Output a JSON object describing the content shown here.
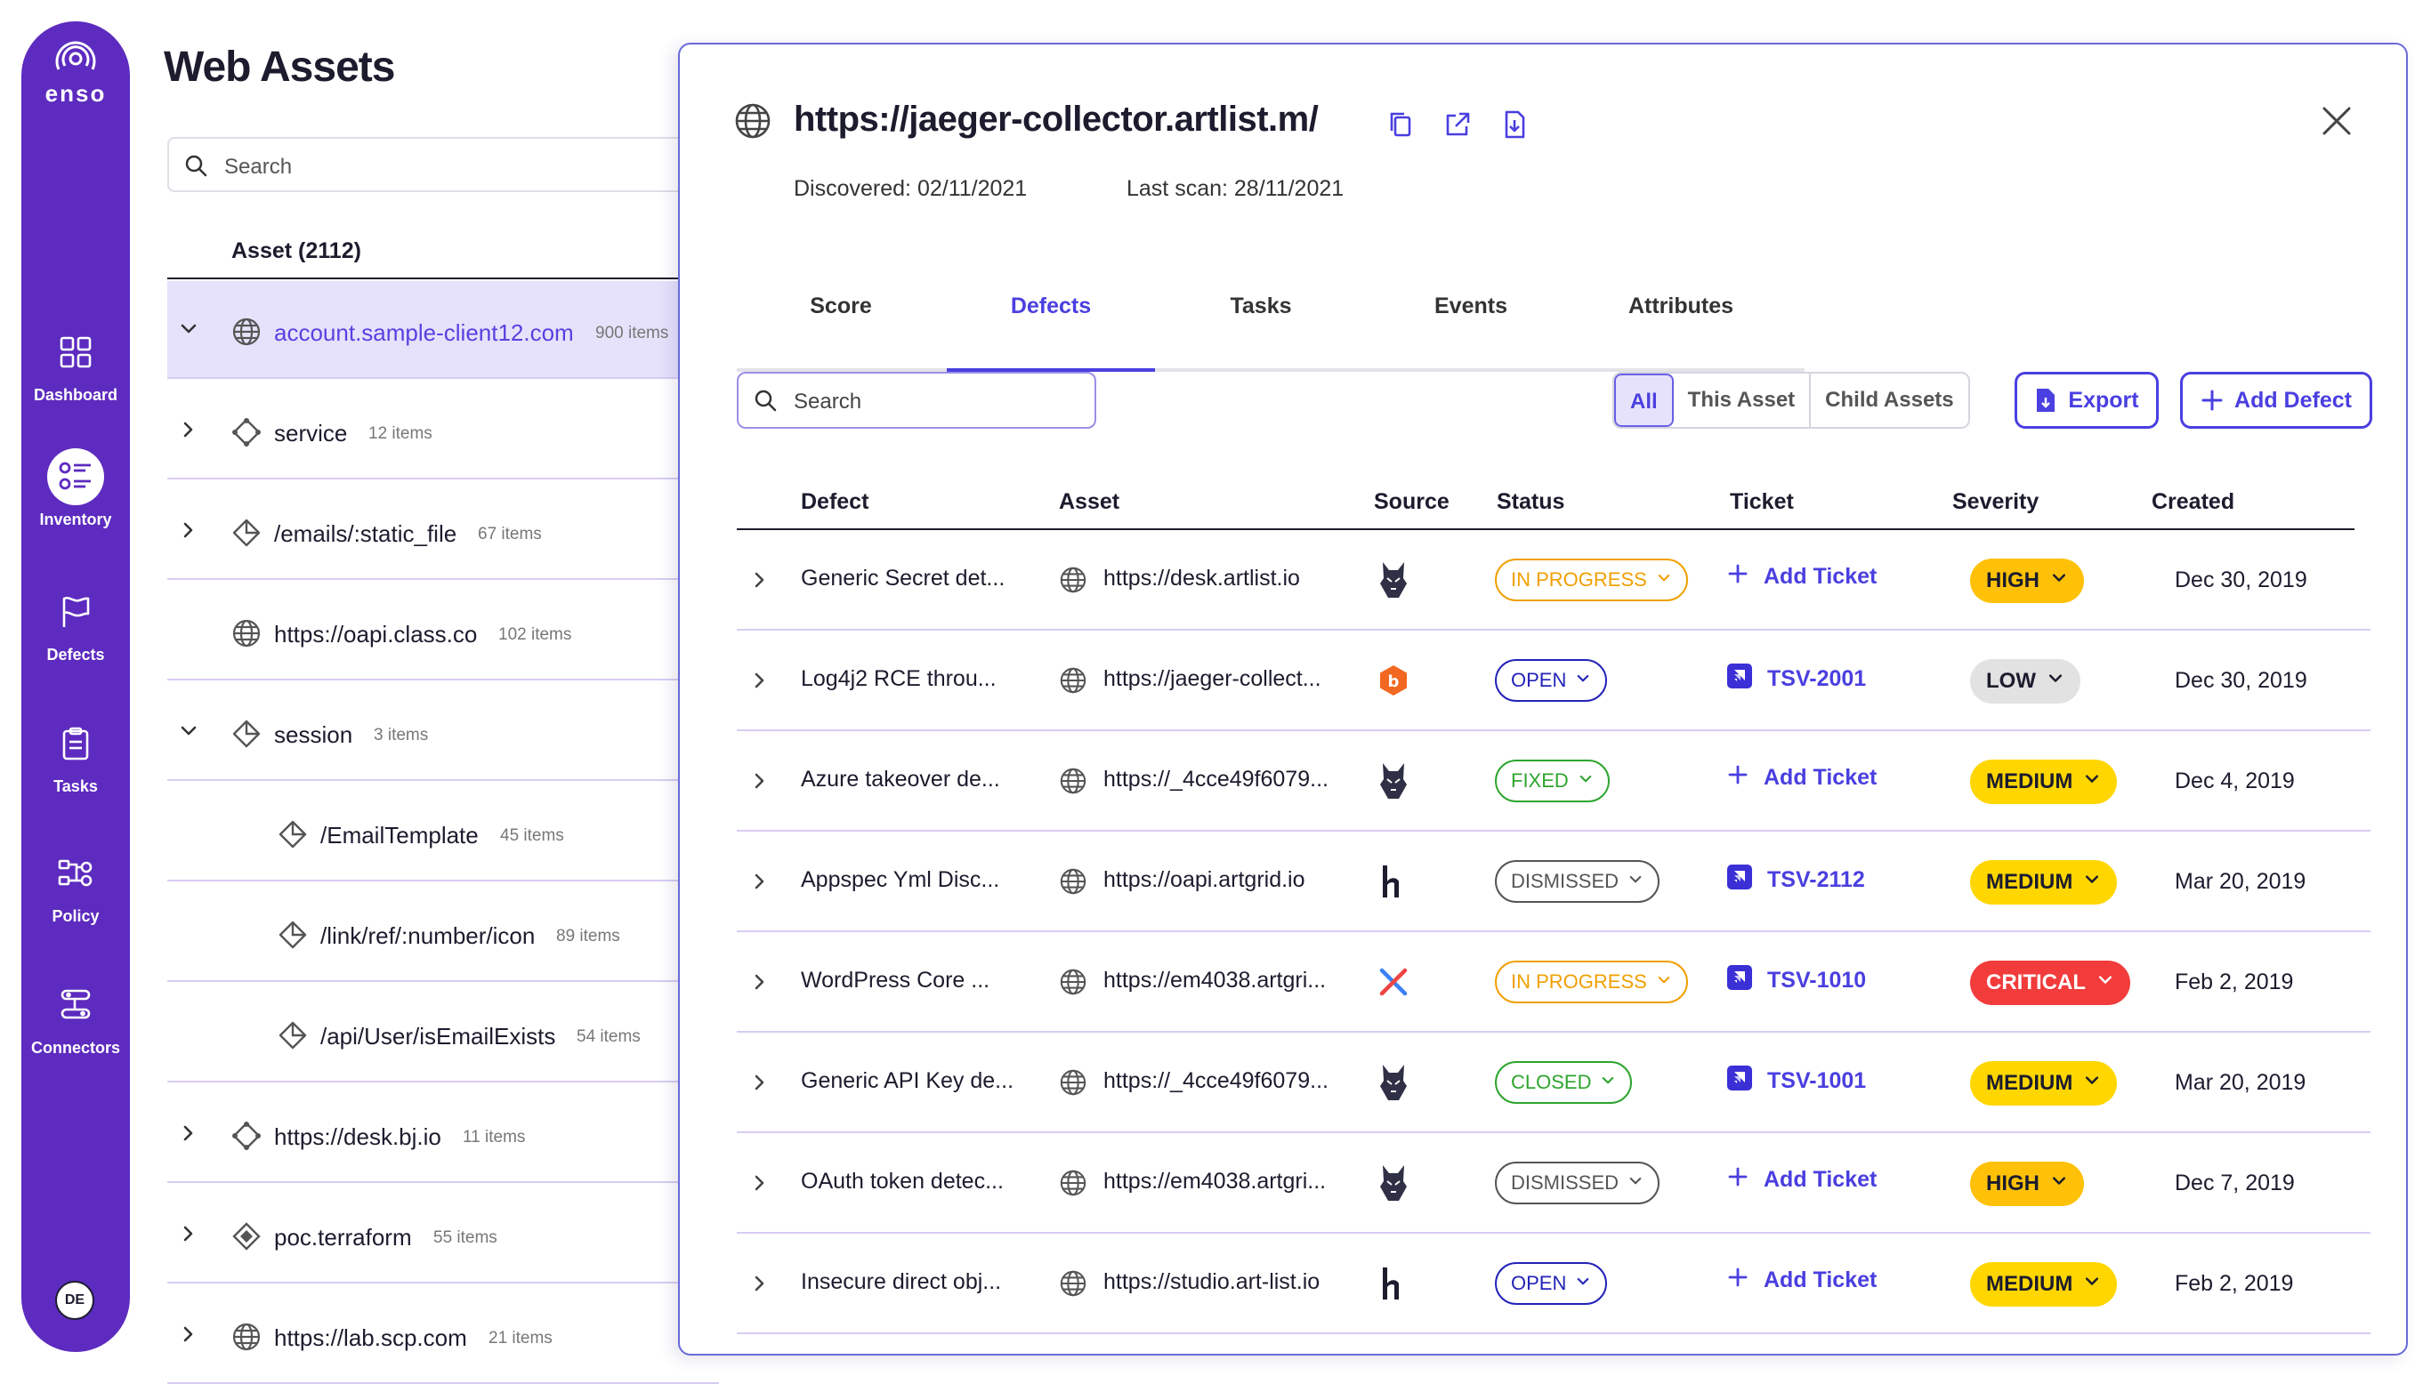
{
  "sidebar": {
    "brand": "enso",
    "items": [
      {
        "label": "Dashboard",
        "icon": "dashboard-icon"
      },
      {
        "label": "Inventory",
        "icon": "inventory-icon",
        "active": true
      },
      {
        "label": "Defects",
        "icon": "flag-icon"
      },
      {
        "label": "Tasks",
        "icon": "clipboard-icon"
      },
      {
        "label": "Policy",
        "icon": "policy-icon"
      },
      {
        "label": "Connectors",
        "icon": "connectors-icon"
      }
    ],
    "user_initials": "DE"
  },
  "assets": {
    "title": "Web Assets",
    "search_placeholder": "Search",
    "column_header": "Asset (2112)",
    "rows": [
      {
        "name": "account.sample-client12.com",
        "count": "900 items",
        "icon": "globe-icon",
        "expand": "expanded",
        "selected": true
      },
      {
        "name": "service",
        "count": "12 items",
        "icon": "service-icon",
        "expand": "collapsed"
      },
      {
        "name": "/emails/:static_file",
        "count": "67 items",
        "icon": "diamond-icon",
        "expand": "collapsed"
      },
      {
        "name": "https://oapi.class.co",
        "count": "102 items",
        "icon": "globe-icon",
        "expand": "none"
      },
      {
        "name": "session",
        "count": "3 items",
        "icon": "diamond-icon",
        "expand": "expanded"
      },
      {
        "name": "/EmailTemplate",
        "count": "45 items",
        "icon": "diamond-icon",
        "expand": "none",
        "child": true
      },
      {
        "name": "/link/ref/:number/icon",
        "count": "89 items",
        "icon": "diamond-icon",
        "expand": "none",
        "child": true
      },
      {
        "name": "/api/User/isEmailExists",
        "count": "54 items",
        "icon": "diamond-icon",
        "expand": "none",
        "child": true
      },
      {
        "name": "https://desk.bj.io",
        "count": "11 items",
        "icon": "service-icon",
        "expand": "collapsed"
      },
      {
        "name": "poc.terraform",
        "count": "55 items",
        "icon": "diamond-dot-icon",
        "expand": "collapsed"
      },
      {
        "name": "https://lab.scp.com",
        "count": "21 items",
        "icon": "globe-icon",
        "expand": "collapsed"
      }
    ]
  },
  "detail": {
    "title": "https://jaeger-collector.artlist.m/",
    "discovered": "Discovered: 02/11/2021",
    "last_scan": "Last scan: 28/11/2021",
    "tabs": [
      {
        "label": "Score"
      },
      {
        "label": "Defects",
        "active": true
      },
      {
        "label": "Tasks"
      },
      {
        "label": "Events"
      },
      {
        "label": "Attributes"
      }
    ],
    "search_placeholder": "Search",
    "filters": [
      {
        "label": "All",
        "active": true
      },
      {
        "label": "This Asset"
      },
      {
        "label": "Child Assets"
      }
    ],
    "export_label": "Export",
    "add_defect_label": "Add Defect",
    "columns": {
      "defect": "Defect",
      "asset": "Asset",
      "source": "Source",
      "status": "Status",
      "ticket": "Ticket",
      "severity": "Severity",
      "created": "Created"
    },
    "defects": [
      {
        "defect": "Generic Secret det...",
        "asset": "https://desk.artlist.io",
        "source": "wolf-logo-icon",
        "status": "IN PROGRESS",
        "ticket": "Add Ticket",
        "ticket_type": "add",
        "severity": "HIGH",
        "created": "Dec 30, 2019"
      },
      {
        "defect": "Log4j2 RCE throu...",
        "asset": "https://jaeger-collect...",
        "source": "bugcrowd-logo-icon",
        "status": "OPEN",
        "ticket": "TSV-2001",
        "ticket_type": "jira",
        "severity": "LOW",
        "created": "Dec 30, 2019"
      },
      {
        "defect": "Azure takeover de...",
        "asset": "https://_4cce49f6079...",
        "source": "wolf-logo-icon",
        "status": "FIXED",
        "ticket": "Add Ticket",
        "ticket_type": "add",
        "severity": "MEDIUM",
        "created": "Dec 4, 2019"
      },
      {
        "defect": "Appspec Yml Disc...",
        "asset": "https://oapi.artgrid.io",
        "source": "hackerone-logo-icon",
        "status": "DISMISSED",
        "ticket": "TSV-2112",
        "ticket_type": "jira",
        "severity": "MEDIUM",
        "created": "Mar 20, 2019"
      },
      {
        "defect": "WordPress Core ...",
        "asset": "https://em4038.artgri...",
        "source": "cross-logo-icon",
        "status": "IN PROGRESS",
        "ticket": "TSV-1010",
        "ticket_type": "jira",
        "severity": "CRITICAL",
        "created": "Feb 2, 2019"
      },
      {
        "defect": "Generic API Key de...",
        "asset": "https://_4cce49f6079...",
        "source": "wolf-logo-icon",
        "status": "CLOSED",
        "ticket": "TSV-1001",
        "ticket_type": "jira",
        "severity": "MEDIUM",
        "created": "Mar 20, 2019"
      },
      {
        "defect": "OAuth token detec...",
        "asset": "https://em4038.artgri...",
        "source": "wolf-logo-icon",
        "status": "DISMISSED",
        "ticket": "Add Ticket",
        "ticket_type": "add",
        "severity": "HIGH",
        "created": "Dec 7, 2019"
      },
      {
        "defect": "Insecure direct obj...",
        "asset": "https://studio.art-list.io",
        "source": "hackerone-logo-icon",
        "status": "OPEN",
        "ticket": "Add Ticket",
        "ticket_type": "add",
        "severity": "MEDIUM",
        "created": "Feb 2, 2019"
      }
    ]
  },
  "colors": {
    "brand_purple": "#5d2bbf",
    "accent": "#4a3fe0",
    "status": {
      "IN PROGRESS": "#f0a000",
      "OPEN": "#2323b8",
      "FIXED": "#2ea52e",
      "CLOSED": "#2ea52e",
      "DISMISSED": "#555555"
    },
    "severity": {
      "HIGH": "#ffc107",
      "MEDIUM": "#ffd600",
      "LOW": "#e2e2e2",
      "CRITICAL": "#f23b3b"
    }
  }
}
